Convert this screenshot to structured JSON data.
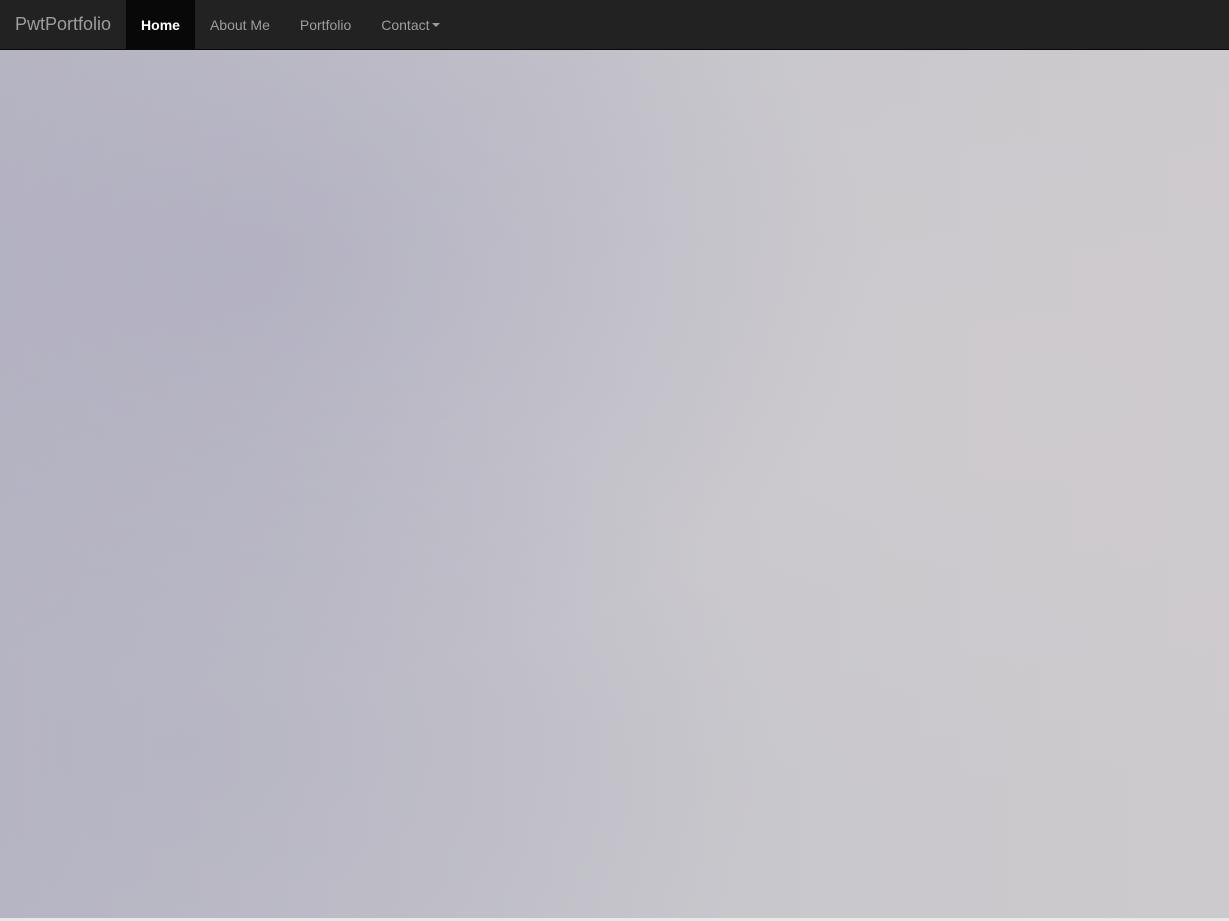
{
  "navbar": {
    "brand": "PwtPortfolio",
    "items": [
      {
        "label": "Home",
        "active": true
      },
      {
        "label": "About Me",
        "active": false
      },
      {
        "label": "Portfolio",
        "active": false
      },
      {
        "label": "Contact",
        "active": false,
        "dropdown": true
      }
    ]
  },
  "colors": {
    "navbar_bg": "#222222",
    "active_bg": "#080808",
    "nav_text": "#9d9d9d",
    "active_text": "#ffffff",
    "hero_bg": "#c3c2c8"
  },
  "icons": {
    "contact_dropdown": "caret-down-icon"
  }
}
